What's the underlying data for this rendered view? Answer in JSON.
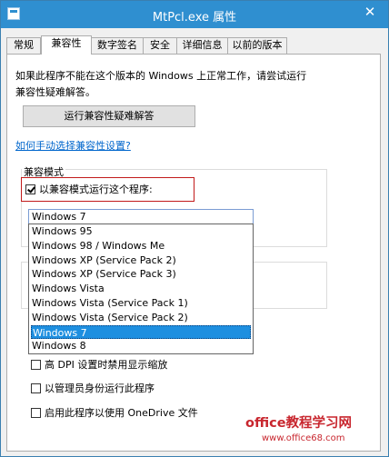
{
  "window": {
    "title": "MtPcl.exe 属性",
    "close_label": "✕"
  },
  "tabs": [
    {
      "label": "常规"
    },
    {
      "label": "兼容性"
    },
    {
      "label": "数字签名"
    },
    {
      "label": "安全"
    },
    {
      "label": "详细信息"
    },
    {
      "label": "以前的版本"
    }
  ],
  "compat": {
    "description": "如果此程序不能在这个版本的 Windows 上正常工作，请尝试运行兼容性疑难解答。",
    "troubleshoot_button": "运行兼容性疑难解答",
    "help_link": "如何手动选择兼容性设置?",
    "group_label": "兼容模式",
    "mode_checkbox_label": "以兼容模式运行这个程序:",
    "selected_value": "Windows 7",
    "options": [
      "Windows 95",
      "Windows 98 / Windows Me",
      "Windows XP (Service Pack 2)",
      "Windows XP (Service Pack 3)",
      "Windows Vista",
      "Windows Vista (Service Pack 1)",
      "Windows Vista (Service Pack 2)",
      "Windows 7",
      "Windows 8"
    ],
    "settings": [
      "高 DPI 设置时禁用显示缩放",
      "以管理员身份运行此程序",
      "启用此程序以使用 OneDrive 文件"
    ]
  },
  "watermark": {
    "brand": "office教程学习网",
    "url": "www.office68.com"
  },
  "colors": {
    "titlebar": "#2f8fd0",
    "selection": "#1e8fe0",
    "highlight_border": "#c21a1a",
    "watermark": "#c8262e"
  }
}
